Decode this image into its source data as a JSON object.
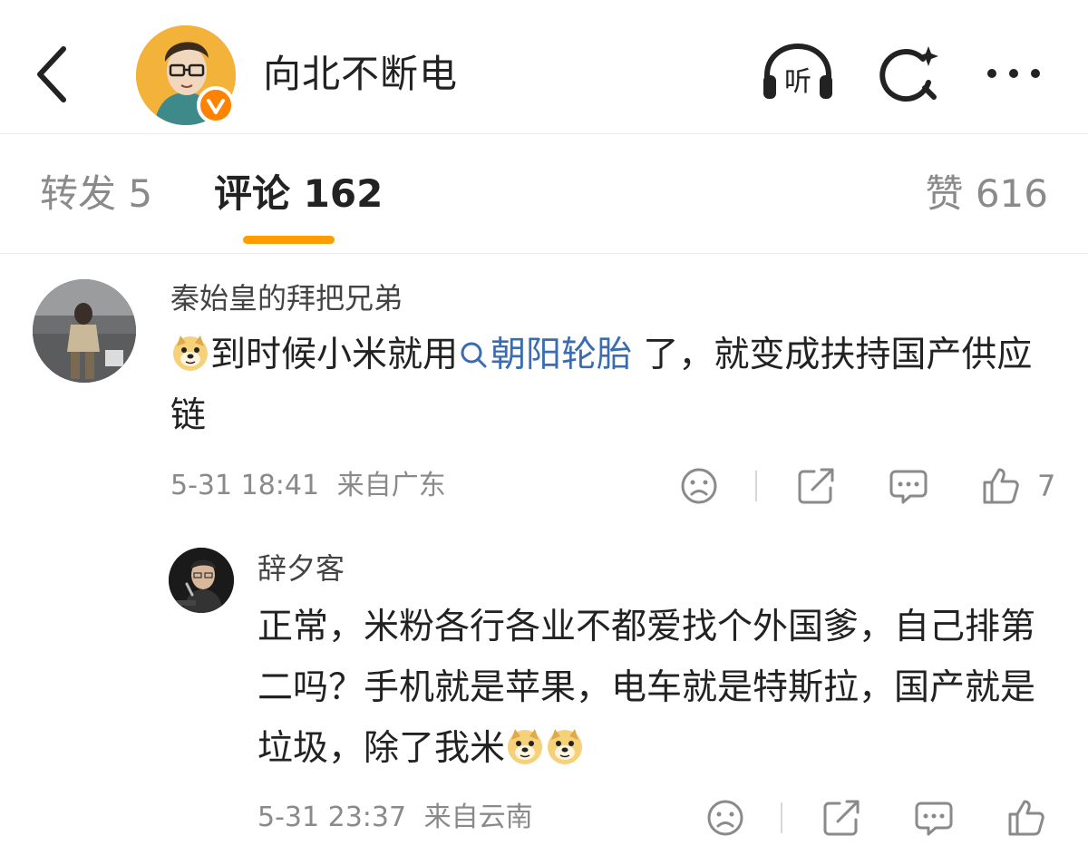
{
  "header": {
    "title": "向北不断电",
    "back_icon": "chevron-left-icon",
    "listen_label": "听",
    "search_icon": "search-sparkle-icon",
    "more_icon": "more-dots-icon"
  },
  "tabs": {
    "repost": "转发 5",
    "comment": "评论 162",
    "like": "赞 616",
    "active_color": "#ff9c00"
  },
  "comments": [
    {
      "username": "秦始皇的拜把兄弟",
      "text_before": "到时候小米就用",
      "topic": "朝阳轮胎",
      "text_after": " 了，就变成扶持国产供应链",
      "time": "5-31 18:41",
      "location": "来自广东",
      "likes": "7"
    }
  ],
  "replies": [
    {
      "username": "辞夕客",
      "text": "正常，米粉各行各业不都爱找个外国爹，自己排第二吗？手机就是苹果，电车就是特斯拉，国产就是垃圾，除了我米",
      "time": "5-31 23:37",
      "location": "来自云南"
    }
  ],
  "colors": {
    "link": "#3b6bb0",
    "muted": "#8a8a8a",
    "verified_badge": "#ff8200"
  }
}
